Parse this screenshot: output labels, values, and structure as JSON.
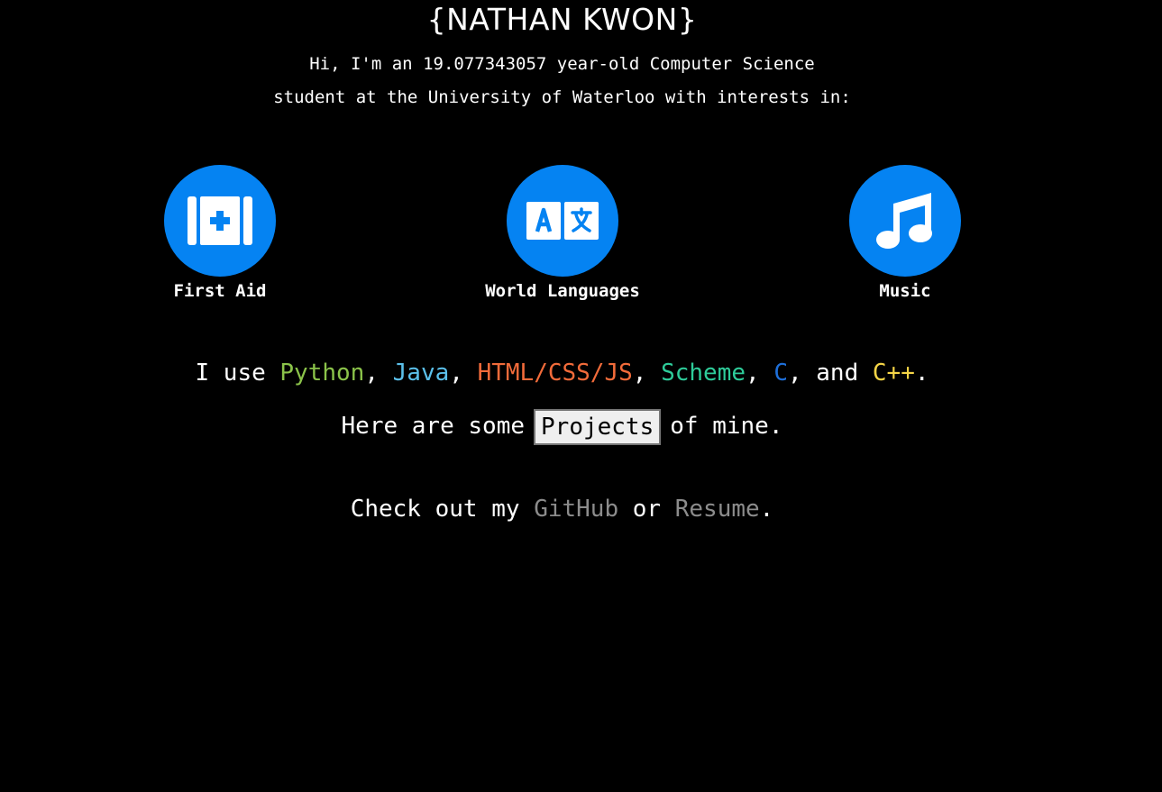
{
  "header": {
    "title": "{NATHAN KWON}"
  },
  "intro": {
    "line1": "Hi, I'm an 19.077343057 year-old Computer Science",
    "line2": "student at the University of Waterloo with interests in:"
  },
  "interests": [
    {
      "label": "First Aid",
      "icon": "first-aid-kit-icon",
      "color": "#0583f2"
    },
    {
      "label": "World Languages",
      "icon": "translate-icon",
      "color": "#0583f2"
    },
    {
      "label": "Music",
      "icon": "music-note-icon",
      "color": "#0583f2"
    }
  ],
  "languages": {
    "prefix": "I use ",
    "sep": ", ",
    "and": ", and ",
    "end": ".",
    "items": [
      {
        "name": "Python",
        "color": "#8bc34a"
      },
      {
        "name": "Java",
        "color": "#5bc0eb"
      },
      {
        "name": "HTML/CSS/JS",
        "color": "#f26b3a"
      },
      {
        "name": "Scheme",
        "color": "#2ecc9a"
      },
      {
        "name": "C",
        "color": "#1e6fd9"
      },
      {
        "name": "C++",
        "color": "#f5d547"
      }
    ]
  },
  "projects": {
    "before": "Here are some",
    "button_label": "Projects",
    "after": "of mine."
  },
  "links": {
    "before": "Check out my ",
    "github": "GitHub",
    "middle": " or ",
    "resume": "Resume",
    "end": ".",
    "link_color": "#8c8c8c"
  }
}
